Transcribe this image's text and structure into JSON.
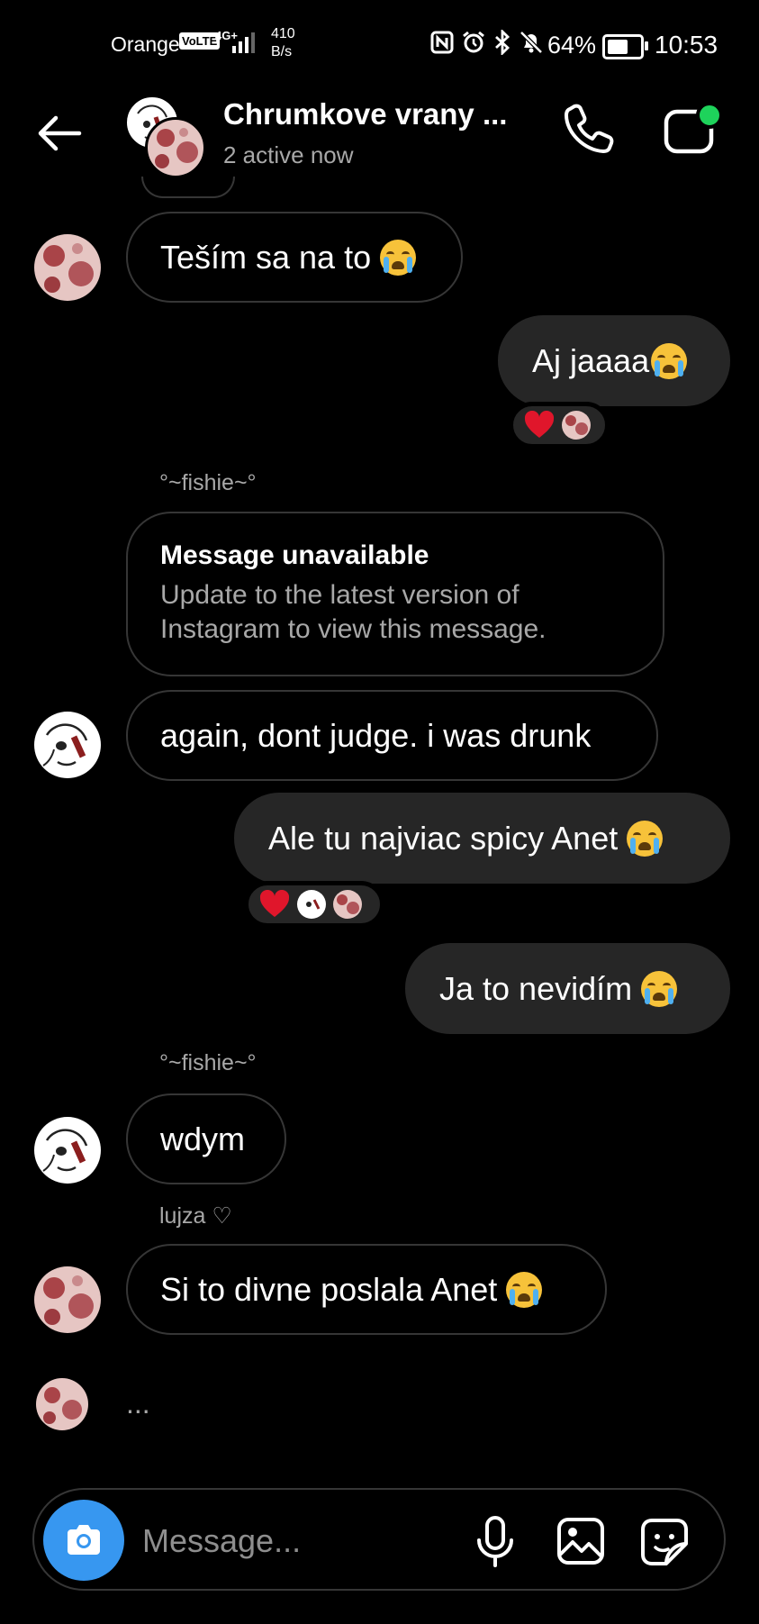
{
  "status_bar": {
    "carrier": "Orange",
    "volte": "VoLTE",
    "network": "4G+",
    "speed_value": "410",
    "speed_unit": "B/s",
    "battery": "64%",
    "battery_level": 0.64,
    "time": "10:53"
  },
  "header": {
    "title": "Chrumkove vrany ...",
    "subtitle": "2 active now"
  },
  "messages": {
    "m1": {
      "text": "Teším sa na to"
    },
    "m2": {
      "text": "Aj jaaaa"
    },
    "m3": {
      "sender": "°~fishie~°",
      "title": "Message unavailable",
      "text": "Update to the latest version of Instagram to view this message."
    },
    "m4": {
      "text": "again, dont judge. i was drunk"
    },
    "m5": {
      "text": "Ale tu najviac spicy Anet"
    },
    "m6": {
      "text": "Ja to nevidím"
    },
    "m7": {
      "sender": "°~fishie~°",
      "text": "wdym"
    },
    "m8": {
      "sender": "lujza ♡",
      "text": "Si to divne poslala Anet"
    },
    "typing": "..."
  },
  "composer": {
    "placeholder": "Message..."
  },
  "colors": {
    "background": "#000000",
    "bubble_out": "#262626",
    "bubble_border": "#363636",
    "accent": "#3797f0",
    "online": "#1ed35b",
    "heart": "#e0162b"
  },
  "icons": [
    "back-arrow-icon",
    "phone-icon",
    "video-call-icon",
    "camera-icon",
    "microphone-icon",
    "gallery-icon",
    "sticker-icon",
    "heart-icon"
  ]
}
